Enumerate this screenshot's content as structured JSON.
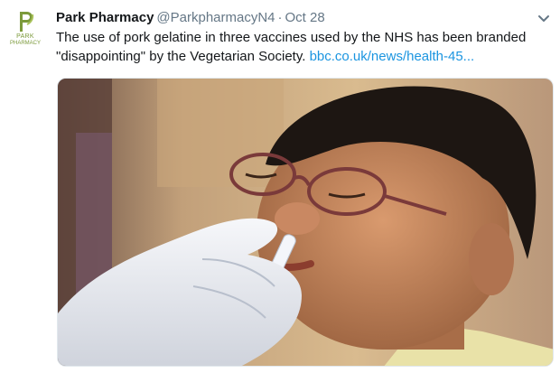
{
  "tweet": {
    "avatar": {
      "line1": "PARK",
      "line2": "PHARMACY",
      "icon": "park-pharmacy-logo"
    },
    "author_name": "Park Pharmacy",
    "handle": "@ParkpharmacyN4",
    "separator": "·",
    "date": "Oct 28",
    "text": "The use of pork gelatine in three vaccines used by the NHS has been branded \"disappointing\" by the Vegetarian Society.",
    "link_text": "bbc.co.uk/news/health-45...",
    "menu_icon": "chevron-down-icon",
    "media": {
      "icon": "photo-boy-nasal-spray-vaccine"
    }
  },
  "colors": {
    "name": "#14171a",
    "secondary": "#657786",
    "link": "#1b95e0",
    "logo": "#7c9a3b"
  }
}
